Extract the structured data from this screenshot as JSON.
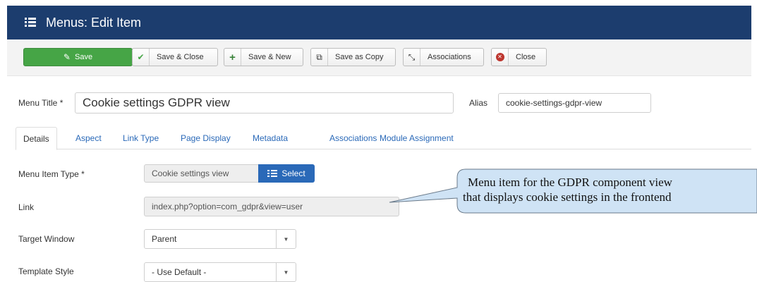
{
  "header": {
    "title": "Menus: Edit Item"
  },
  "toolbar": {
    "save": "Save",
    "save_close": "Save & Close",
    "save_new": "Save & New",
    "save_copy": "Save as Copy",
    "associations": "Associations",
    "close": "Close"
  },
  "form": {
    "menu_title_label": "Menu Title *",
    "menu_title_value": "Cookie settings GDPR view",
    "alias_label": "Alias",
    "alias_value": "cookie-settings-gdpr-view"
  },
  "tabs": [
    "Details",
    "Aspect",
    "Link Type",
    "Page Display",
    "Metadata",
    "Associations",
    "Module Assignment"
  ],
  "details": {
    "menu_item_type_label": "Menu Item Type *",
    "menu_item_type_value": "Cookie settings view",
    "select_label": "Select",
    "link_label": "Link",
    "link_value": "index.php?option=com_gdpr&view=user",
    "target_window_label": "Target Window",
    "target_window_value": "Parent",
    "template_style_label": "Template Style",
    "template_style_value": "- Use Default -"
  },
  "callout": {
    "line1": "Menu item for the GDPR component view",
    "line2": "that displays cookie settings in the frontend"
  },
  "colors": {
    "header": "#1c3d6e",
    "save": "#46a546",
    "accent": "#2a69b8",
    "callout": "#cfe3f5"
  }
}
